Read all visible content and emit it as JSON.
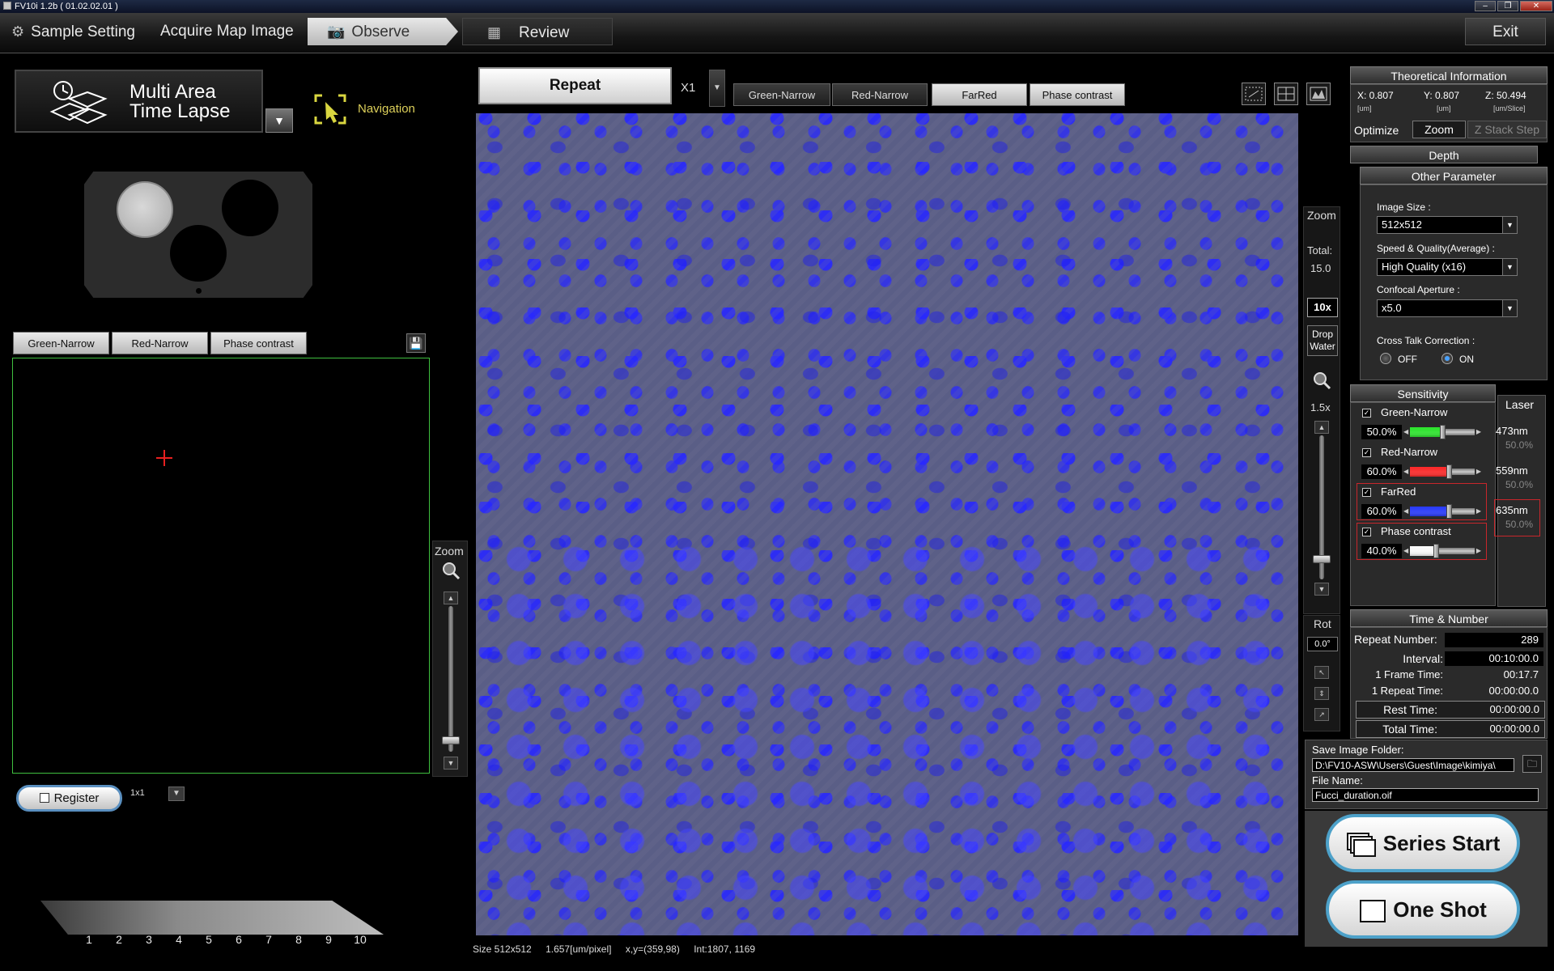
{
  "window": {
    "title": "FV10i 1.2b ( 01.02.02.01 )"
  },
  "main_nav": {
    "sample_setting": "Sample Setting",
    "acquire_map_image": "Acquire Map Image",
    "observe": "Observe",
    "review": "Review",
    "exit": "Exit"
  },
  "left_panel": {
    "mode_line1": "Multi Area",
    "mode_line2": "Time Lapse",
    "navigation": "Navigation",
    "channels": [
      "Green-Narrow",
      "Red-Narrow",
      "Phase contrast"
    ],
    "zoom_label": "Zoom",
    "register": "Register",
    "grid": "1x1",
    "timeline": [
      "1",
      "2",
      "3",
      "4",
      "5",
      "6",
      "7",
      "8",
      "9",
      "10"
    ]
  },
  "top_bar": {
    "repeat": "Repeat",
    "repeat_count": "X1",
    "channels": [
      {
        "label": "Green-Narrow",
        "active": false
      },
      {
        "label": "Red-Narrow",
        "active": false
      },
      {
        "label": "FarRed",
        "active": true
      },
      {
        "label": "Phase contrast",
        "active": true
      }
    ]
  },
  "status_bar": {
    "size": "Size 512x512",
    "resolution": "1.657[um/pixel]",
    "coords": "x,y=(359,98)",
    "intensity": "Int:1807, 1169"
  },
  "zoom_column": {
    "zoom": "Zoom",
    "total_label": "Total:",
    "total_value": "15.0",
    "objective": "10x",
    "drop_water_1": "Drop",
    "drop_water_2": "Water",
    "digital_zoom": "1.5x",
    "rot_label": "Rot",
    "rot_value": "0.0°"
  },
  "theoretical_info": {
    "title": "Theoretical Information",
    "x": "X: 0.807",
    "y": "Y: 0.807",
    "z": "Z: 50.494",
    "x_unit": "[um]",
    "y_unit": "[um]",
    "z_unit": "[um/Slice]",
    "optimize": "Optimize",
    "zoom_btn": "Zoom",
    "zstack_btn": "Z Stack Step"
  },
  "depth": {
    "title": "Depth"
  },
  "other_param": {
    "title": "Other Parameter",
    "image_size_label": "Image Size :",
    "image_size": "512x512",
    "speed_label": "Speed & Quality(Average) :",
    "speed": "High Quality (x16)",
    "aperture_label": "Confocal Aperture :",
    "aperture": "x5.0",
    "crosstalk_label": "Cross Talk Correction :",
    "off": "OFF",
    "on": "ON",
    "crosstalk_selected": "ON"
  },
  "sensitivity": {
    "title": "Sensitivity",
    "laser_title": "Laser",
    "rows": [
      {
        "name": "Green-Narrow",
        "value": "50.0%",
        "level": 0.5,
        "color": "#2ee82e",
        "laser": "473nm",
        "laser_pct": "50.0%"
      },
      {
        "name": "Red-Narrow",
        "value": "60.0%",
        "level": 0.6,
        "color": "#ff2a2a",
        "laser": "559nm",
        "laser_pct": "50.0%"
      },
      {
        "name": "FarRed",
        "value": "60.0%",
        "level": 0.6,
        "color": "#2a3cff",
        "laser": "635nm",
        "laser_pct": "50.0%"
      },
      {
        "name": "Phase contrast",
        "value": "40.0%",
        "level": 0.4,
        "color": "#ffffff"
      }
    ]
  },
  "time_number": {
    "title": "Time & Number",
    "repeat_number_label": "Repeat Number:",
    "repeat_number": "289",
    "interval_label": "Interval:",
    "interval": "00:10:00.0",
    "frame_time_label": "1 Frame Time:",
    "frame_time": "00:17.7",
    "repeat_time_label": "1 Repeat Time:",
    "repeat_time": "00:00:00.0",
    "rest_time_label": "Rest Time:",
    "rest_time": "00:00:00.0",
    "total_time_label": "Total Time:",
    "total_time": "00:00:00.0"
  },
  "save": {
    "folder_label": "Save Image Folder:",
    "folder": "D:\\FV10-ASW\\Users\\Guest\\Image\\kimiya\\",
    "file_label": "File Name:",
    "file": "Fucci_duration.oif"
  },
  "actions": {
    "series_start": "Series Start",
    "one_shot": "One Shot"
  }
}
